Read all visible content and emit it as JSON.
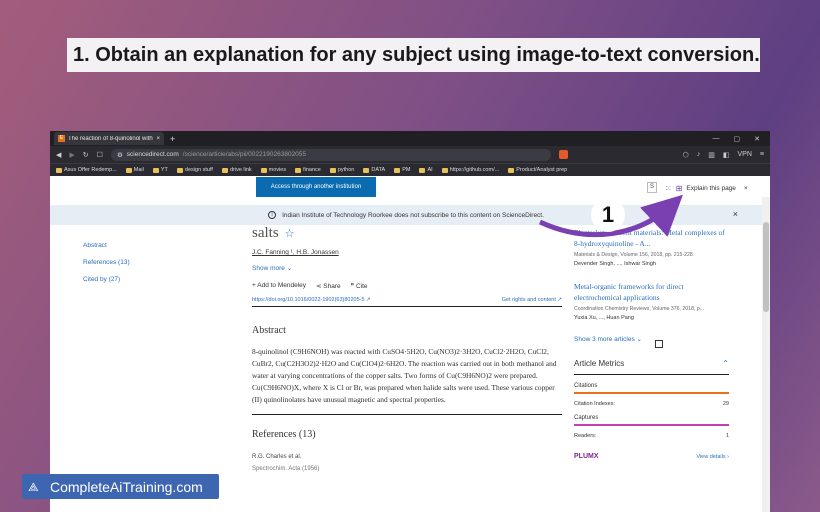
{
  "headline": "1.  Obtain an explanation for any subject using image-to-text conversion.",
  "browser": {
    "tab_title": "The reaction of 8-quinolinol with",
    "tab_favicon": "E",
    "new_tab": "+",
    "url_host": "sciencedirect.com",
    "url_path": "/science/article/abs/pii/0022190263802055",
    "vpn_label": "VPN",
    "bookmarks": [
      "Asus Offer Redemp...",
      "Mail",
      "YT",
      "design stuff",
      "drive link",
      "movies",
      "finance",
      "python",
      "DATA",
      "PM",
      "AI",
      "https://github.com/...",
      "Product/Analyst prep"
    ]
  },
  "page": {
    "access_button": "Access through another institution",
    "search_fragment": "S",
    "explain_label": "Explain this page",
    "explain_close": "×",
    "notice_text": "Indian Institute of Technology Roorkee does not subscribe to this content on ScienceDirect.",
    "notice_close": "×",
    "left_nav": [
      "Abstract",
      "References (13)",
      "Cited by (27)"
    ],
    "title_fragment": "salts",
    "authors": "J.C. Fanning ¹, H.B. Jonassen",
    "show_more": "Show more",
    "actions": [
      "+  Add to Mendeley",
      "Share",
      "Cite"
    ],
    "doi": "https://doi.org/10.1016/0022-1902(63)80205-5",
    "rights": "Get rights and content",
    "abstract_heading": "Abstract",
    "abstract_text": "8-quinolinol (C9H6NOH) was reacted with CuSO4·5H2O, Cu(NO3)2·3H2O, CuCl2·2H2O, CuCl2, CuBr2, Cu(C2H3O2)2·H2O and Cu(ClO4)2·6H2O. The reaction was carried out in both methanol and water at varying concentrations of the copper salts. Two forms of Cu(C9H6NO)2 were prepared. Cu(C9H6NO)X, where X is Cl or Br, was prepared when halide salts were used. These various copper (II) quinolinolates have unusual magnetic and spectral properties.",
    "references_heading": "References (13)",
    "ref1_author": "R.G. Charles et al.",
    "ref1_journal": "Spectrochim. Acta (1956)",
    "related": [
      {
        "title": "Electroluminescent materials: Metal complexes of 8-hydroxyquinoline - A...",
        "meta": "Materials & Design, Volume 156, 2018, pp. 215-228",
        "authors": "Devender Singh, ..., Ishwar Singh"
      },
      {
        "title": "Metal-organic frameworks for direct electrochemical applications",
        "meta": "Coordination Chemistry Reviews, Volume 376, 2018, p...",
        "authors": "Yuxia Xu, ..., Huan Pang"
      }
    ],
    "show_more_articles": "Show 3 more articles",
    "metrics_heading": "Article Metrics",
    "citations_label": "Citations",
    "citation_indexes_label": "Citation Indexes:",
    "citation_indexes_value": "29",
    "captures_label": "Captures",
    "readers_label": "Readers:",
    "readers_value": "1",
    "plumx": "PLUMX",
    "view_details": "View details",
    "citations_color": "#e9711c",
    "captures_color": "#c23fb0"
  },
  "overlay": {
    "step_number": "1",
    "watermark": "CompleteAiTraining.com"
  }
}
